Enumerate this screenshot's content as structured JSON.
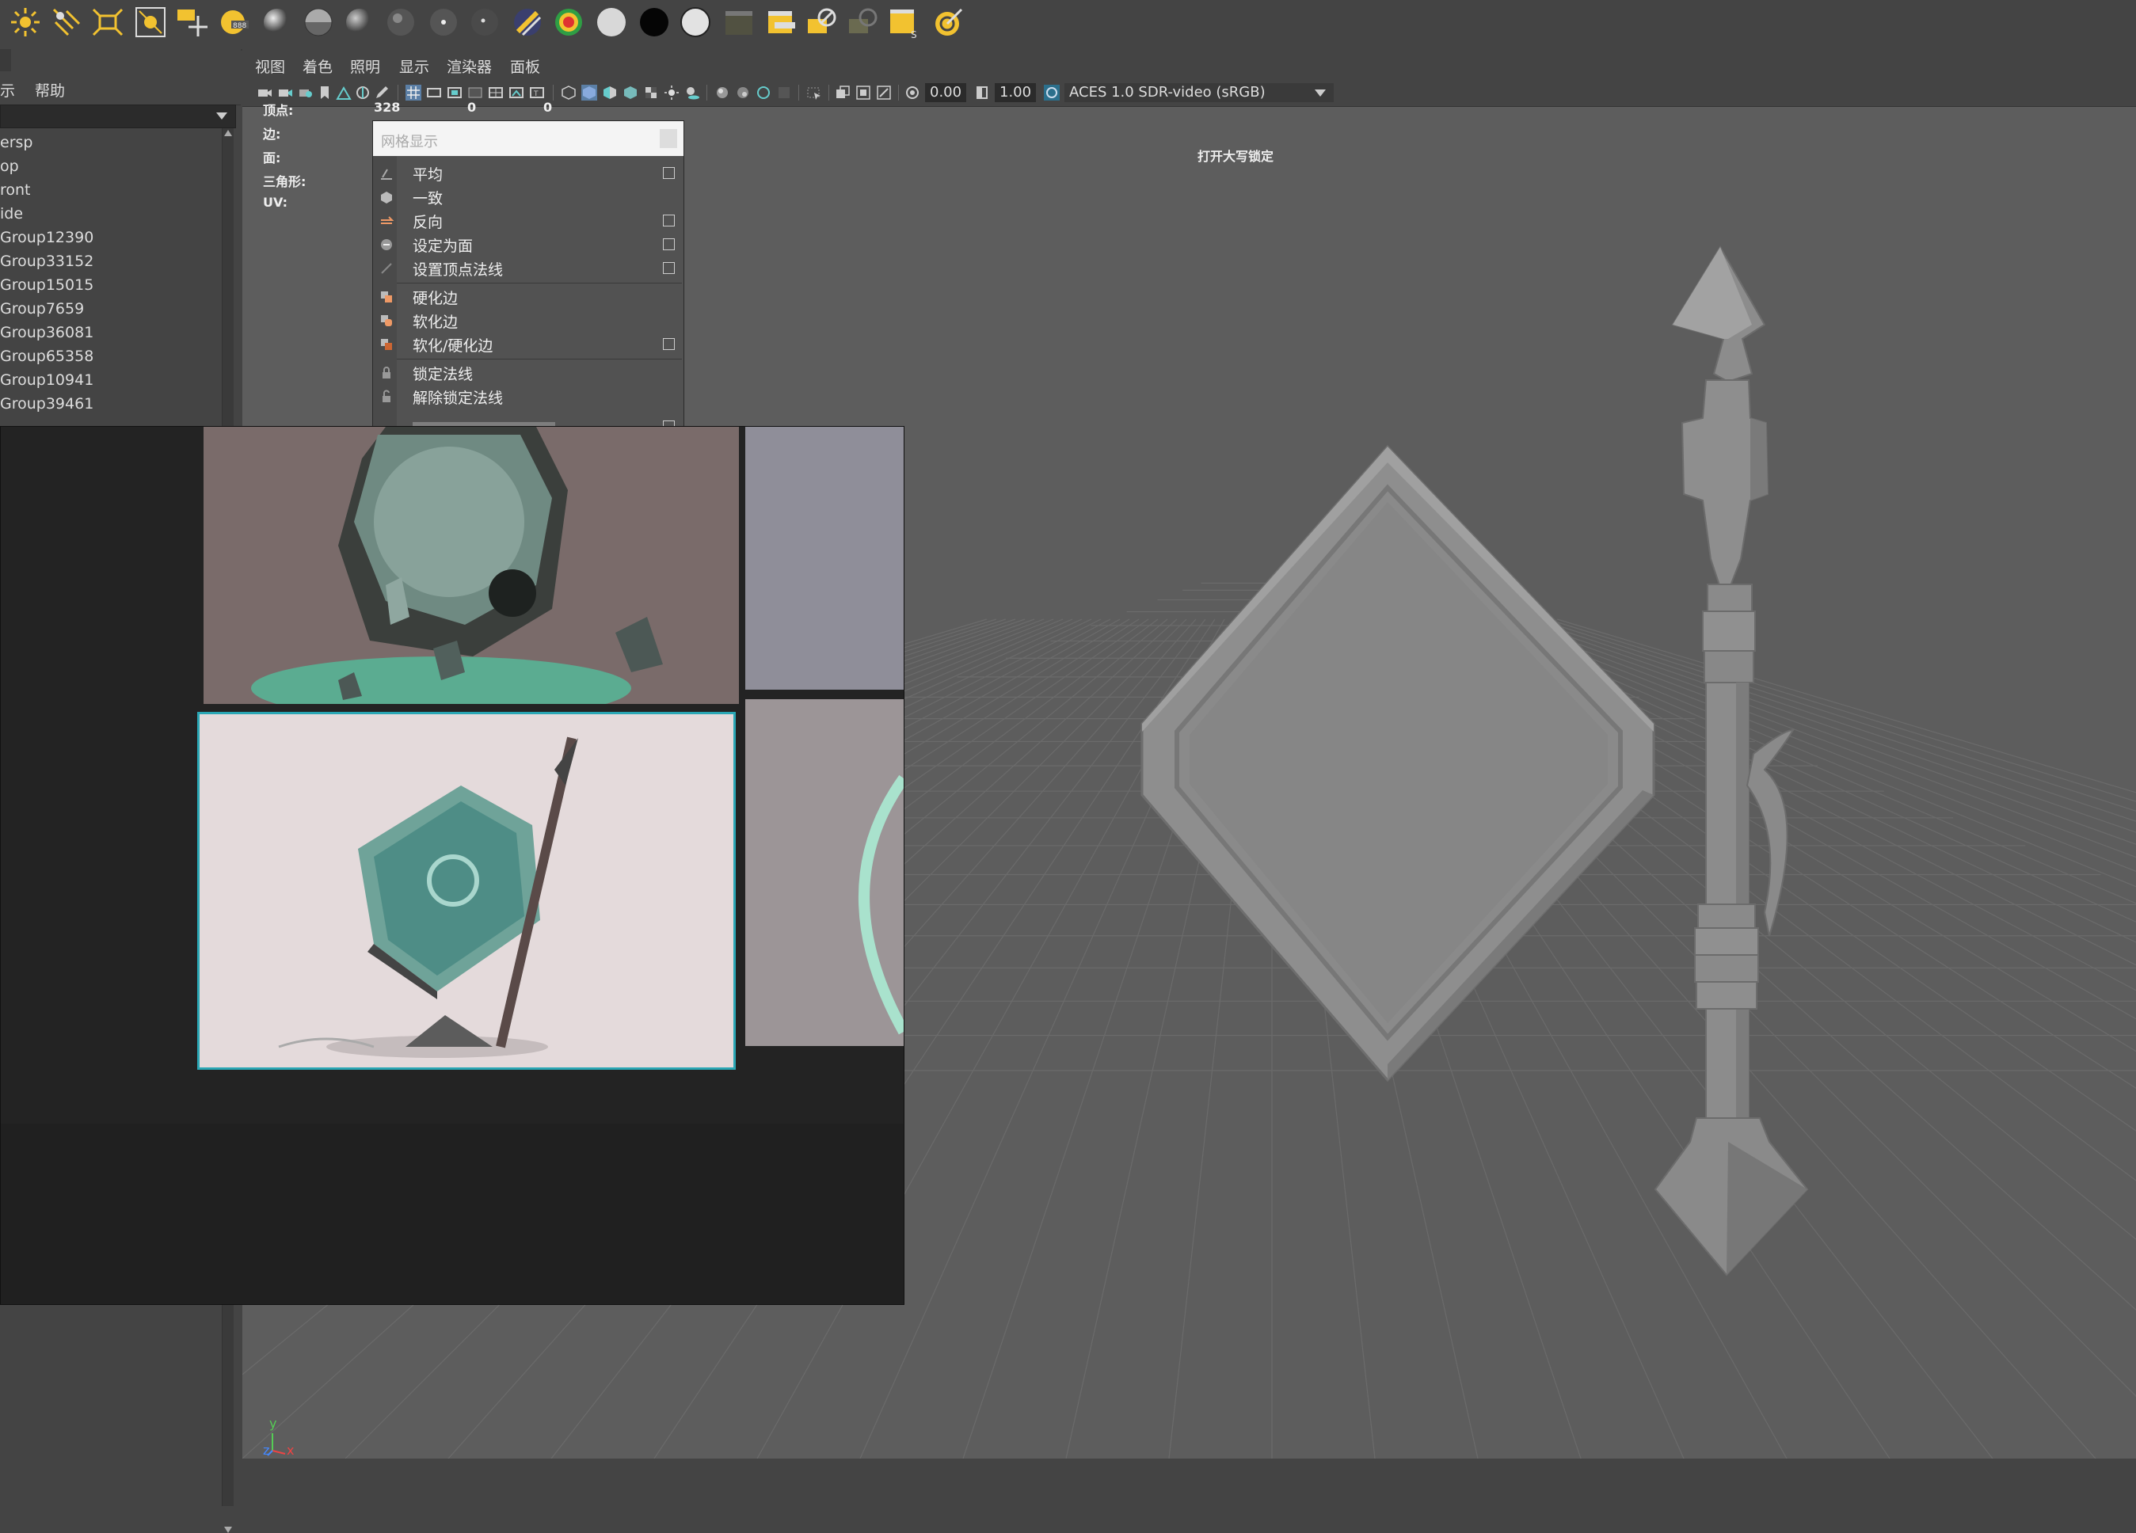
{
  "shelf": {
    "icons": [
      "sun-icon",
      "tilted-light-icon",
      "area-light-icon",
      "spot-box-icon",
      "move-tool-icon",
      "render-tag-icon",
      "sphere-icon",
      "sphere-half-icon",
      "sphere-dark-icon",
      "sphere-dark-icon",
      "sphere-dot-icon",
      "sphere-dot-icon",
      "striped-sphere-icon",
      "rainbow-sphere-icon",
      "white-circle-icon",
      "black-circle-icon",
      "white-circle-icon",
      "clapper-icon",
      "clapper-icon",
      "clapper-icon",
      "clapper-icon",
      "clapper-icon",
      "target-icon"
    ]
  },
  "outliner": {
    "menu": {
      "show_label": "示",
      "help_label": "帮助"
    },
    "items": [
      "ersp",
      "op",
      "ront",
      "ide",
      "Group12390",
      "Group33152",
      "Group15015",
      "Group7659",
      "Group36081",
      "Group65358",
      "Group10941",
      "Group39461"
    ]
  },
  "viewport": {
    "menu": [
      "视图",
      "着色",
      "照明",
      "显示",
      "渲染器",
      "面板"
    ],
    "toolbar": {
      "exposure_value": "0.00",
      "gamma_value": "1.00",
      "colorspace_label": "ACES 1.0 SDR-video (sRGB)"
    },
    "hud": {
      "vertex_label": "顶点:",
      "vertex_value": "328",
      "vertex_col2": "0",
      "vertex_col3": "0",
      "edge_label": "边:",
      "face_label": "面:",
      "tri_label": "三角形:",
      "uv_label": "UV:",
      "caps_lock": "打开大写锁定"
    },
    "axis": {
      "y": "y",
      "z": "z",
      "x": "x"
    }
  },
  "mesh_menu": {
    "title": "网格显示",
    "items": [
      {
        "label": "平均",
        "box": true
      },
      {
        "label": "一致",
        "box": false
      },
      {
        "label": "反向",
        "box": true
      },
      {
        "label": "设定为面",
        "box": true
      },
      {
        "label": "设置顶点法线",
        "box": true
      },
      {
        "label": "硬化边",
        "box": false
      },
      {
        "label": "软化边",
        "box": false
      },
      {
        "label": "软化/硬化边",
        "box": true
      },
      {
        "label": "锁定法线",
        "box": false
      },
      {
        "label": "解除锁定法线",
        "box": false
      }
    ]
  },
  "colors": {
    "accent_teal": "#2aa6b4",
    "viewport_bg": "#5d5d5d",
    "panel_bg": "#444444"
  }
}
